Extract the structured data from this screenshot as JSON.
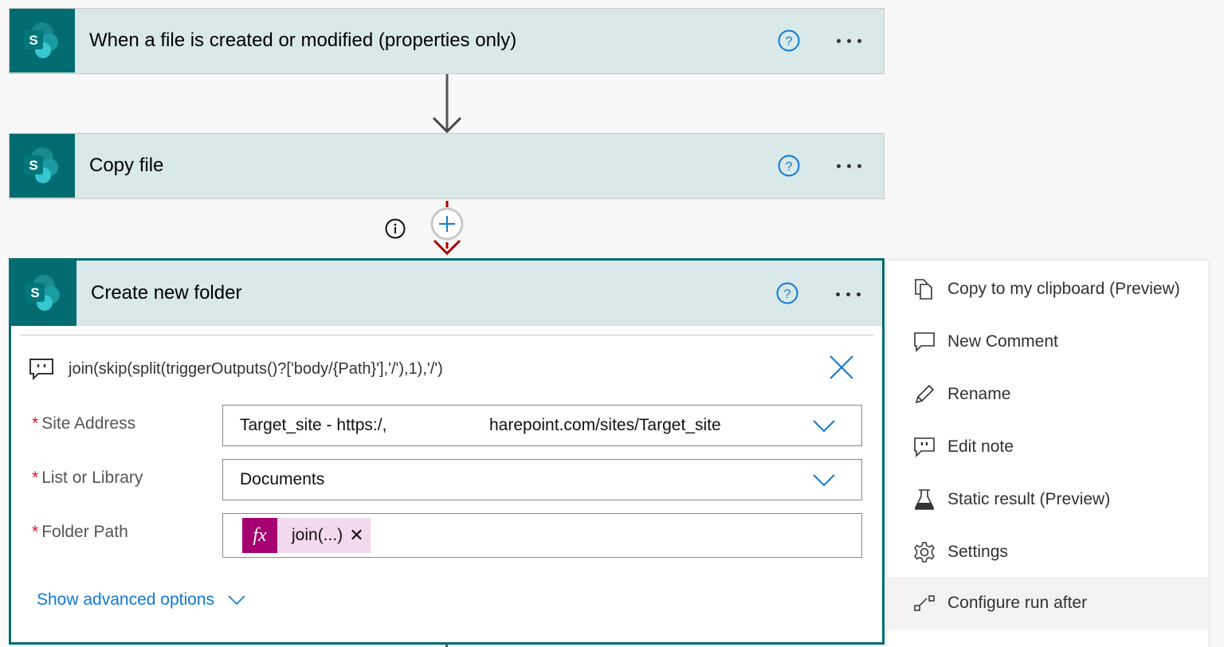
{
  "colors": {
    "sharepoint_teal": "#036c70",
    "card_header_bg": "#d9e8e8",
    "accent_blue": "#0f78d4",
    "required_red": "#e81123",
    "expression_magenta": "#a4006f",
    "expression_token_bg": "#f2d9ee",
    "connector_red": "#a80000"
  },
  "flow": {
    "steps": [
      {
        "title": "When a file is created or modified (properties only)",
        "connector_icon": "sharepoint-icon"
      },
      {
        "title": "Copy file",
        "connector_icon": "sharepoint-icon"
      },
      {
        "title": "Create new folder",
        "connector_icon": "sharepoint-icon"
      }
    ],
    "insert_step_icon": "plus-icon",
    "info_icon": "info-icon"
  },
  "action": {
    "note": "join(skip(split(triggerOutputs()?['body/{Path}'],'/'),1),'/')",
    "fields": [
      {
        "label": "Site Address",
        "required": "*",
        "value_start": "Target_site - https:/,",
        "value_end": "harepoint.com/sites/Target_site",
        "type": "dropdown"
      },
      {
        "label": "List or Library",
        "required": "*",
        "value": "Documents",
        "type": "dropdown"
      },
      {
        "label": "Folder Path",
        "required": "*",
        "token_icon": "fx",
        "token_label": "join(...)",
        "token_remove": "✕",
        "type": "expression"
      }
    ],
    "show_advanced": "Show advanced options"
  },
  "context_menu": {
    "items": [
      {
        "label": "Copy to my clipboard (Preview)",
        "icon": "copy-icon"
      },
      {
        "label": "New Comment",
        "icon": "comment-icon"
      },
      {
        "label": "Rename",
        "icon": "pencil-icon"
      },
      {
        "label": "Edit note",
        "icon": "note-icon"
      },
      {
        "label": "Static result (Preview)",
        "icon": "flask-icon"
      },
      {
        "label": "Settings",
        "icon": "gear-icon"
      },
      {
        "label": "Configure run after",
        "icon": "run-after-icon",
        "highlighted": true
      }
    ]
  }
}
